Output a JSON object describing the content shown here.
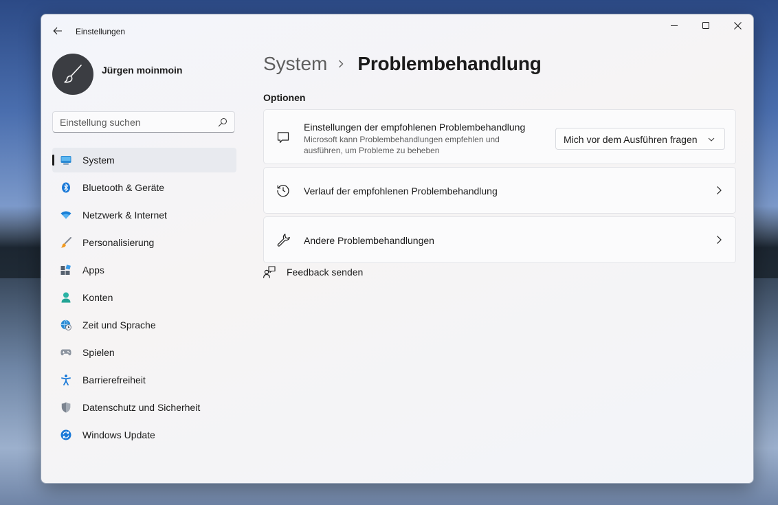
{
  "window": {
    "title": "Einstellungen",
    "controls": {
      "minimize": "minimize-icon",
      "maximize": "maximize-icon",
      "close": "close-icon"
    }
  },
  "user": {
    "name": "Jürgen moinmoin",
    "avatar_icon": "paintbrush-icon"
  },
  "search": {
    "placeholder": "Einstellung suchen",
    "value": ""
  },
  "sidebar": {
    "items": [
      {
        "label": "System",
        "icon": "monitor-icon",
        "active": true
      },
      {
        "label": "Bluetooth & Geräte",
        "icon": "bluetooth-icon"
      },
      {
        "label": "Netzwerk & Internet",
        "icon": "wifi-icon"
      },
      {
        "label": "Personalisierung",
        "icon": "brush-icon"
      },
      {
        "label": "Apps",
        "icon": "apps-icon"
      },
      {
        "label": "Konten",
        "icon": "person-icon"
      },
      {
        "label": "Zeit und Sprache",
        "icon": "globe-clock-icon"
      },
      {
        "label": "Spielen",
        "icon": "gamepad-icon"
      },
      {
        "label": "Barrierefreiheit",
        "icon": "accessibility-icon"
      },
      {
        "label": "Datenschutz und Sicherheit",
        "icon": "shield-icon"
      },
      {
        "label": "Windows Update",
        "icon": "update-icon"
      }
    ]
  },
  "breadcrumb": {
    "parent": "System",
    "current": "Problembehandlung"
  },
  "section": {
    "title": "Optionen"
  },
  "cards": {
    "recommended": {
      "title": "Einstellungen der empfohlenen Problembehandlung",
      "description": "Microsoft kann Problembehandlungen empfehlen und ausführen, um Probleme zu beheben",
      "dropdown_value": "Mich vor dem Ausführen fragen"
    },
    "history": {
      "title": "Verlauf der empfohlenen Problembehandlung"
    },
    "other": {
      "title": "Andere Problembehandlungen"
    }
  },
  "feedback": {
    "label": "Feedback senden"
  },
  "colors": {
    "accent": "#0067c0",
    "window_bg": "#f3f5fb",
    "card_bg": "#fbfbfc"
  }
}
